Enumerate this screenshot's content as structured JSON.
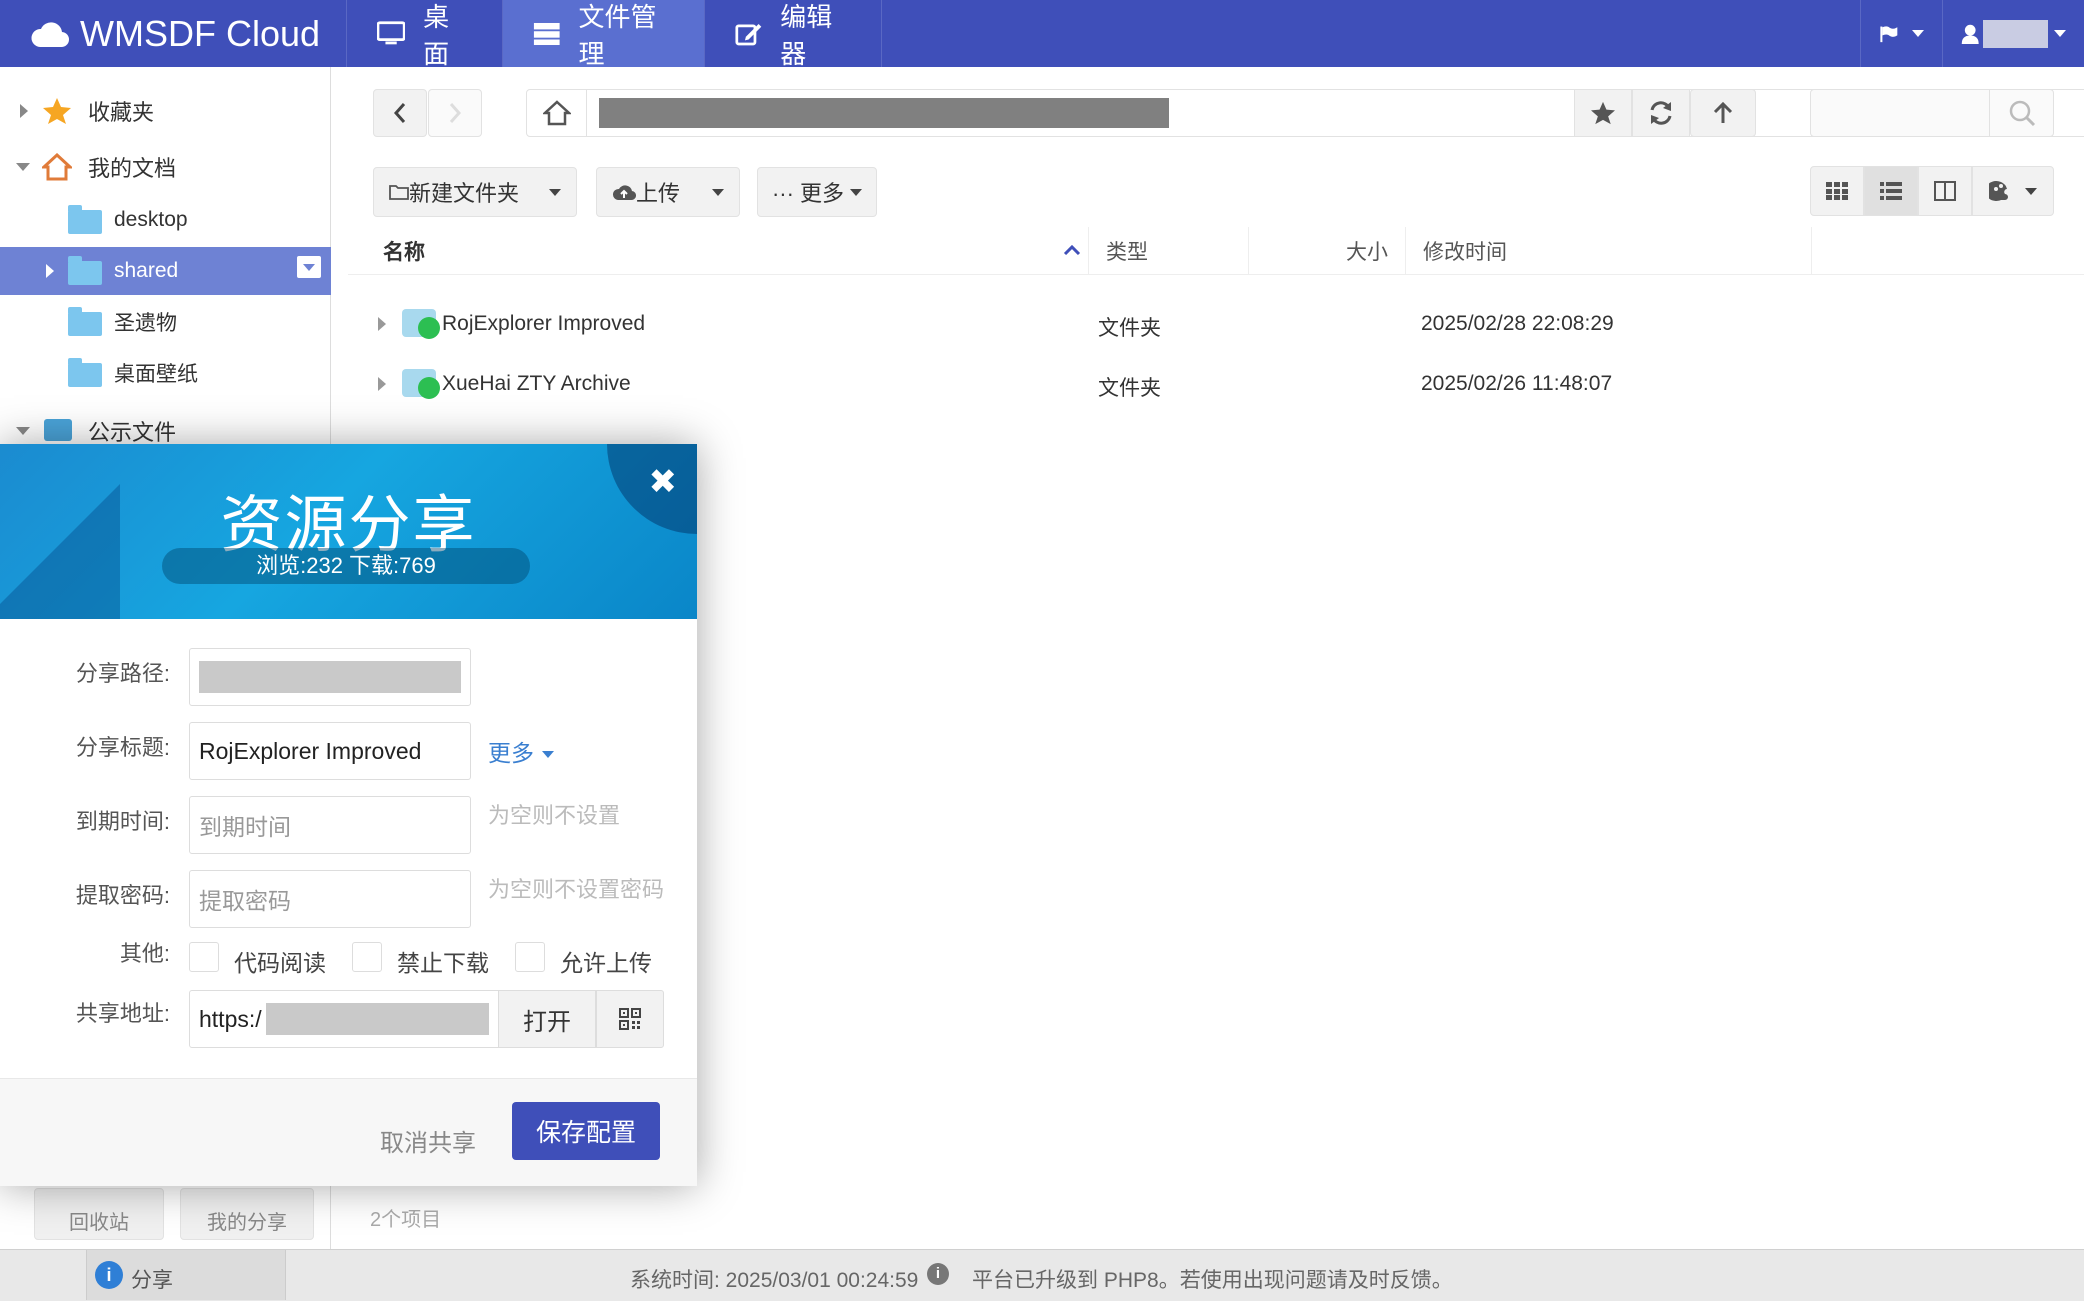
{
  "app": {
    "title": "WMSDF Cloud"
  },
  "nav": {
    "desktop": "桌面",
    "files": "文件管理",
    "editor": "编辑器"
  },
  "tree": {
    "favorites": "收藏夹",
    "my_docs": "我的文档",
    "desktop": "desktop",
    "shared": "shared",
    "relics": "圣遗物",
    "wallpaper": "桌面壁纸",
    "public": "公示文件"
  },
  "toolbar": {
    "new_folder": "新建文件夹",
    "upload": "上传",
    "more": "··· 更多"
  },
  "columns": {
    "name": "名称",
    "type": "类型",
    "size": "大小",
    "modified": "修改时间"
  },
  "files": [
    {
      "name": "RojExplorer Improved",
      "type": "文件夹",
      "modified": "2025/02/28 22:08:29"
    },
    {
      "name": "XueHai ZTY Archive",
      "type": "文件夹",
      "modified": "2025/02/26 11:48:07"
    }
  ],
  "bottom": {
    "recycle": "回收站",
    "my_share": "我的分享",
    "count": "2个项目"
  },
  "statusbar": {
    "task": "分享",
    "system_time": "系统时间: 2025/03/01 00:24:59",
    "notice": "平台已升级到 PHP8。若使用出现问题请及时反馈。"
  },
  "dialog": {
    "title": "资源分享",
    "stats": "浏览:232 下载:769",
    "close": "✖",
    "path_label": "分享路径:",
    "title_label": "分享标题:",
    "title_value": "RojExplorer Improved",
    "more": "更多",
    "expire_label": "到期时间:",
    "expire_placeholder": "到期时间",
    "expire_hint": "为空则不设置",
    "pwd_label": "提取密码:",
    "pwd_placeholder": "提取密码",
    "pwd_hint": "为空则不设置密码",
    "other_label": "其他:",
    "opt_code": "代码阅读",
    "opt_nodl": "禁止下载",
    "opt_upload": "允许上传",
    "url_label": "共享地址:",
    "url_value": "https:/",
    "open": "打开",
    "cancel": "取消共享",
    "save": "保存配置"
  }
}
